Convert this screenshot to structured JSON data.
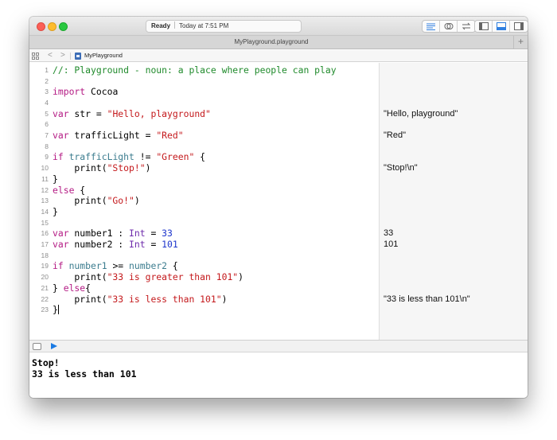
{
  "window": {
    "status": {
      "state": "Ready",
      "time": "Today at 7:51 PM"
    },
    "tab_title": "MyPlayground.playground",
    "add_tab_label": "+"
  },
  "jumpbar": {
    "back_label": "<",
    "forward_label": ">",
    "file_name": "MyPlayground"
  },
  "icons": {
    "editor_standard": "standard-editor-icon",
    "editor_assistant": "assistant-editor-icon",
    "editor_version": "version-editor-icon",
    "navigator": "navigator-toggle-icon",
    "debug": "debug-area-toggle-icon",
    "utilities": "utilities-toggle-icon"
  },
  "colors": {
    "comment": "#1f8a2b",
    "keyword": "#b41b84",
    "string": "#c4191c",
    "number": "#1d35cc",
    "type": "#6e2bab",
    "variable": "#3d7d8f"
  },
  "code": {
    "line_numbers": [
      "1",
      "2",
      "3",
      "4",
      "5",
      "6",
      "7",
      "8",
      "9",
      "10",
      "11",
      "12",
      "13",
      "14",
      "15",
      "16",
      "17",
      "18",
      "19",
      "20",
      "21",
      "22",
      "23"
    ],
    "l1": "//: Playground - noun: a place where people can play",
    "l3_kw": "import",
    "l3_mod": " Cocoa",
    "l5_kw": "var",
    "l5_a": " str = ",
    "l5_str": "\"Hello, playground\"",
    "l7_kw": "var",
    "l7_a": " trafficLight = ",
    "l7_str": "\"Red\"",
    "l9_kw": "if",
    "l9_var": " trafficLight",
    "l9_a": " != ",
    "l9_str": "\"Green\"",
    "l9_b": " {",
    "l10_a": "    print(",
    "l10_str": "\"Stop!\"",
    "l10_b": ")",
    "l11": "}",
    "l12_kw": "else",
    "l12_a": " {",
    "l13_a": "    print(",
    "l13_str": "\"Go!\"",
    "l13_b": ")",
    "l14": "}",
    "l16_kw": "var",
    "l16_a": " number1 : ",
    "l16_ty": "Int",
    "l16_b": " = ",
    "l16_num": "33",
    "l17_kw": "var",
    "l17_a": " number2 : ",
    "l17_ty": "Int",
    "l17_b": " = ",
    "l17_num": "101",
    "l19_kw": "if",
    "l19_v1": " number1",
    "l19_a": " >= ",
    "l19_v2": "number2",
    "l19_b": " {",
    "l20_a": "    print(",
    "l20_str": "\"33 is greater than 101\"",
    "l20_b": ")",
    "l21_a": "} ",
    "l21_kw": "else",
    "l21_b": "{",
    "l22_a": "    print(",
    "l22_str": "\"33 is less than 101\"",
    "l22_b": ")",
    "l23": "}"
  },
  "results": {
    "r5": "\"Hello, playground\"",
    "r7": "\"Red\"",
    "r10": "\"Stop!\\n\"",
    "r16": "33",
    "r17": "101",
    "r22": "\"33 is less than 101\\n\""
  },
  "console": {
    "lines": [
      "Stop!",
      "33 is less than 101"
    ]
  }
}
